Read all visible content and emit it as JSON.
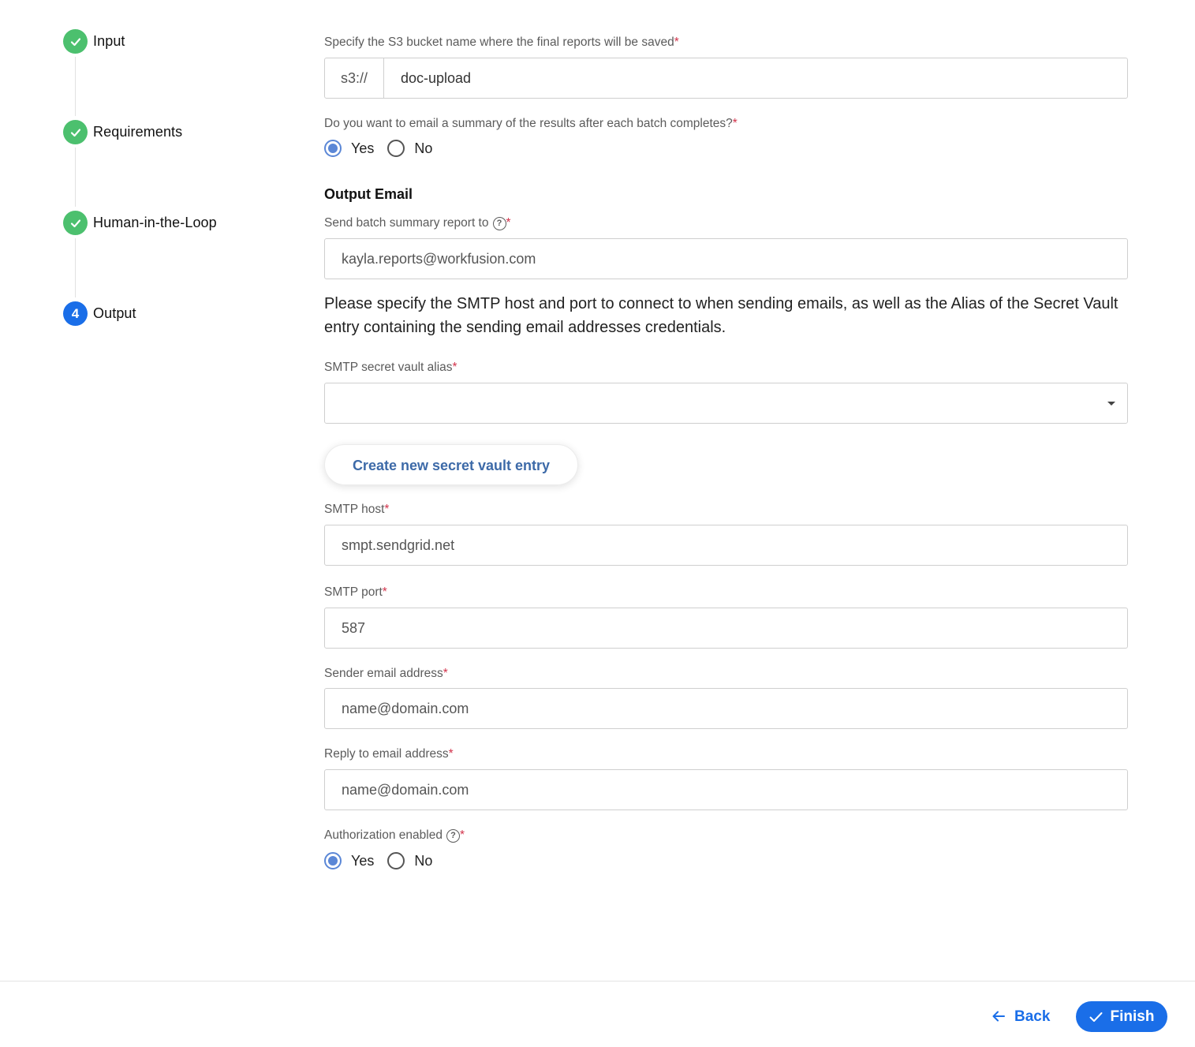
{
  "stepper": {
    "steps": [
      {
        "label": "Input",
        "status": "done",
        "icon": "check-icon"
      },
      {
        "label": "Requirements",
        "status": "done",
        "icon": "check-icon"
      },
      {
        "label": "Human-in-the-Loop",
        "status": "done",
        "icon": "check-icon"
      },
      {
        "label": "Output",
        "status": "active",
        "number": "4"
      }
    ]
  },
  "form": {
    "s3": {
      "label": "Specify the S3 bucket name where the final reports will be saved",
      "prefix": "s3://",
      "value": "doc-upload"
    },
    "email_summary": {
      "label": "Do you want to email a summary of the results after each batch completes?",
      "options": [
        "Yes",
        "No"
      ],
      "selected": "Yes"
    },
    "output_email": {
      "title": "Output Email",
      "send_to_label": "Send batch summary report to",
      "send_to_placeholder": "kayla.reports@workfusion.com",
      "help_icon": "question-circle-icon"
    },
    "smtp_info": "Please specify the SMTP host and port to connect to when sending emails, as well as the Alias of the Secret Vault entry containing the sending email addresses credentials.",
    "smtp_alias": {
      "label": "SMTP secret vault alias",
      "value": ""
    },
    "create_vault_button": "Create new secret vault entry",
    "smtp_host": {
      "label": "SMTP host",
      "placeholder": "smpt.sendgrid.net"
    },
    "smtp_port": {
      "label": "SMTP port",
      "placeholder": "587"
    },
    "sender_email": {
      "label": "Sender email address",
      "placeholder": "name@domain.com"
    },
    "reply_email": {
      "label": "Reply to email address",
      "placeholder": "name@domain.com"
    },
    "authorization": {
      "label": "Authorization enabled",
      "options": [
        "Yes",
        "No"
      ],
      "selected": "Yes"
    },
    "required_mark": "*"
  },
  "footer": {
    "back_label": "Back",
    "finish_label": "Finish"
  },
  "colors": {
    "accent": "#1a6ee8",
    "done": "#4cc06e",
    "required": "#d2334b",
    "radio": "#5b87d6"
  }
}
